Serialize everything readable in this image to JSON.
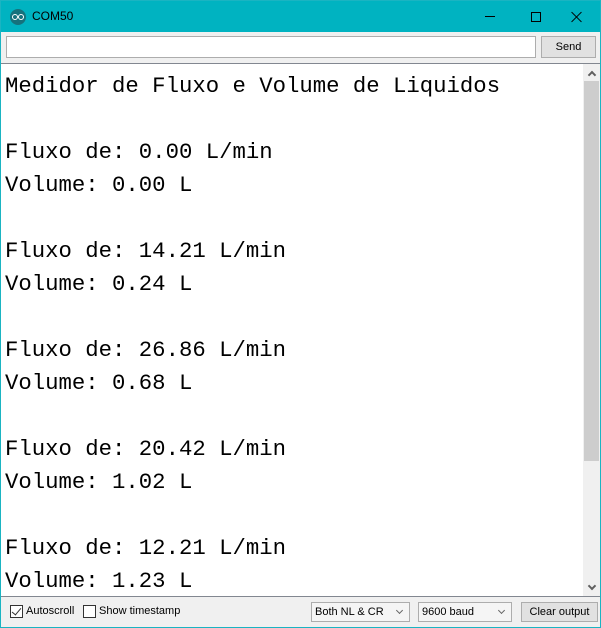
{
  "window": {
    "title": "COM50",
    "app_icon": "arduino-icon",
    "controls": {
      "minimize_icon": "minimize-icon",
      "maximize_icon": "maximize-icon",
      "close_icon": "close-icon"
    },
    "accent_color": "#00b3c1"
  },
  "send_bar": {
    "input_value": "",
    "send_label": "Send"
  },
  "output": {
    "lines": [
      "Medidor de Fluxo e Volume de Liquidos",
      "",
      "Fluxo de: 0.00 L/min",
      "Volume: 0.00 L",
      "",
      "Fluxo de: 14.21 L/min",
      "Volume: 0.24 L",
      "",
      "Fluxo de: 26.86 L/min",
      "Volume: 0.68 L",
      "",
      "Fluxo de: 20.42 L/min",
      "Volume: 1.02 L",
      "",
      "Fluxo de: 12.21 L/min",
      "Volume: 1.23 L"
    ]
  },
  "scrollbar": {
    "up_icon": "chevron-up-icon",
    "down_icon": "chevron-down-icon"
  },
  "status_bar": {
    "autoscroll": {
      "label": "Autoscroll",
      "checked": true
    },
    "show_timestamp": {
      "label": "Show timestamp",
      "checked": false
    },
    "line_ending": {
      "selected": "Both NL & CR"
    },
    "baud_rate": {
      "selected": "9600 baud"
    },
    "clear_label": "Clear output"
  }
}
